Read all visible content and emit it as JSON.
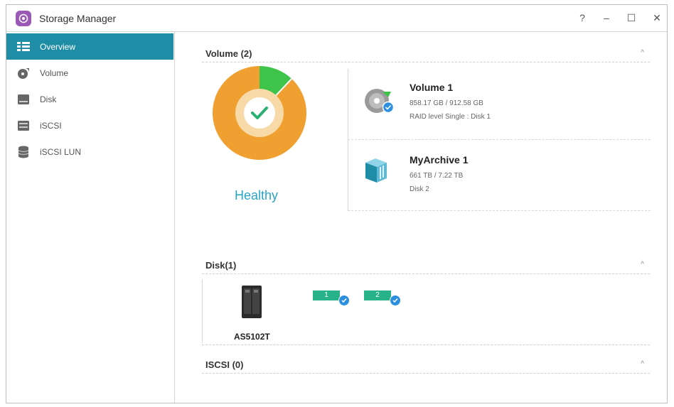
{
  "window": {
    "title": "Storage Manager",
    "help_symbol": "?",
    "minimize_symbol": "–",
    "maximize_symbol": "☐",
    "close_symbol": "✕"
  },
  "sidebar": {
    "items": [
      {
        "label": "Overview",
        "icon": "overview-icon",
        "active": true
      },
      {
        "label": "Volume",
        "icon": "volume-icon"
      },
      {
        "label": "Disk",
        "icon": "disk-icon"
      },
      {
        "label": "iSCSI",
        "icon": "iscsi-icon"
      },
      {
        "label": "iSCSI LUN",
        "icon": "iscsi-lun-icon"
      }
    ]
  },
  "sections": {
    "volume": {
      "title": "Volume (2)",
      "status": "Healthy",
      "donut": {
        "used_fraction": 0.88,
        "colors": {
          "used": "#f0a030",
          "free": "#3fc44a",
          "inner": "#f8d9a8",
          "check": "#2ab070"
        }
      },
      "cards": [
        {
          "title": "Volume 1",
          "capacity": "858.17 GB / 912.58 GB",
          "detail": "RAID level Single : Disk 1"
        },
        {
          "title": "MyArchive 1",
          "capacity": "661 TB / 7.22 TB",
          "detail": "Disk 2"
        }
      ]
    },
    "disk": {
      "title": "Disk(1)",
      "device_name": "AS5102T",
      "slots": [
        "1",
        "2"
      ]
    },
    "iscsi": {
      "title": "ISCSI (0)"
    },
    "collapse_symbol": "^"
  },
  "colors": {
    "accent": "#1f8da6",
    "healthy": "#29a4c6",
    "disk_tag": "#27b28a",
    "check_badge": "#2d8fe0"
  }
}
